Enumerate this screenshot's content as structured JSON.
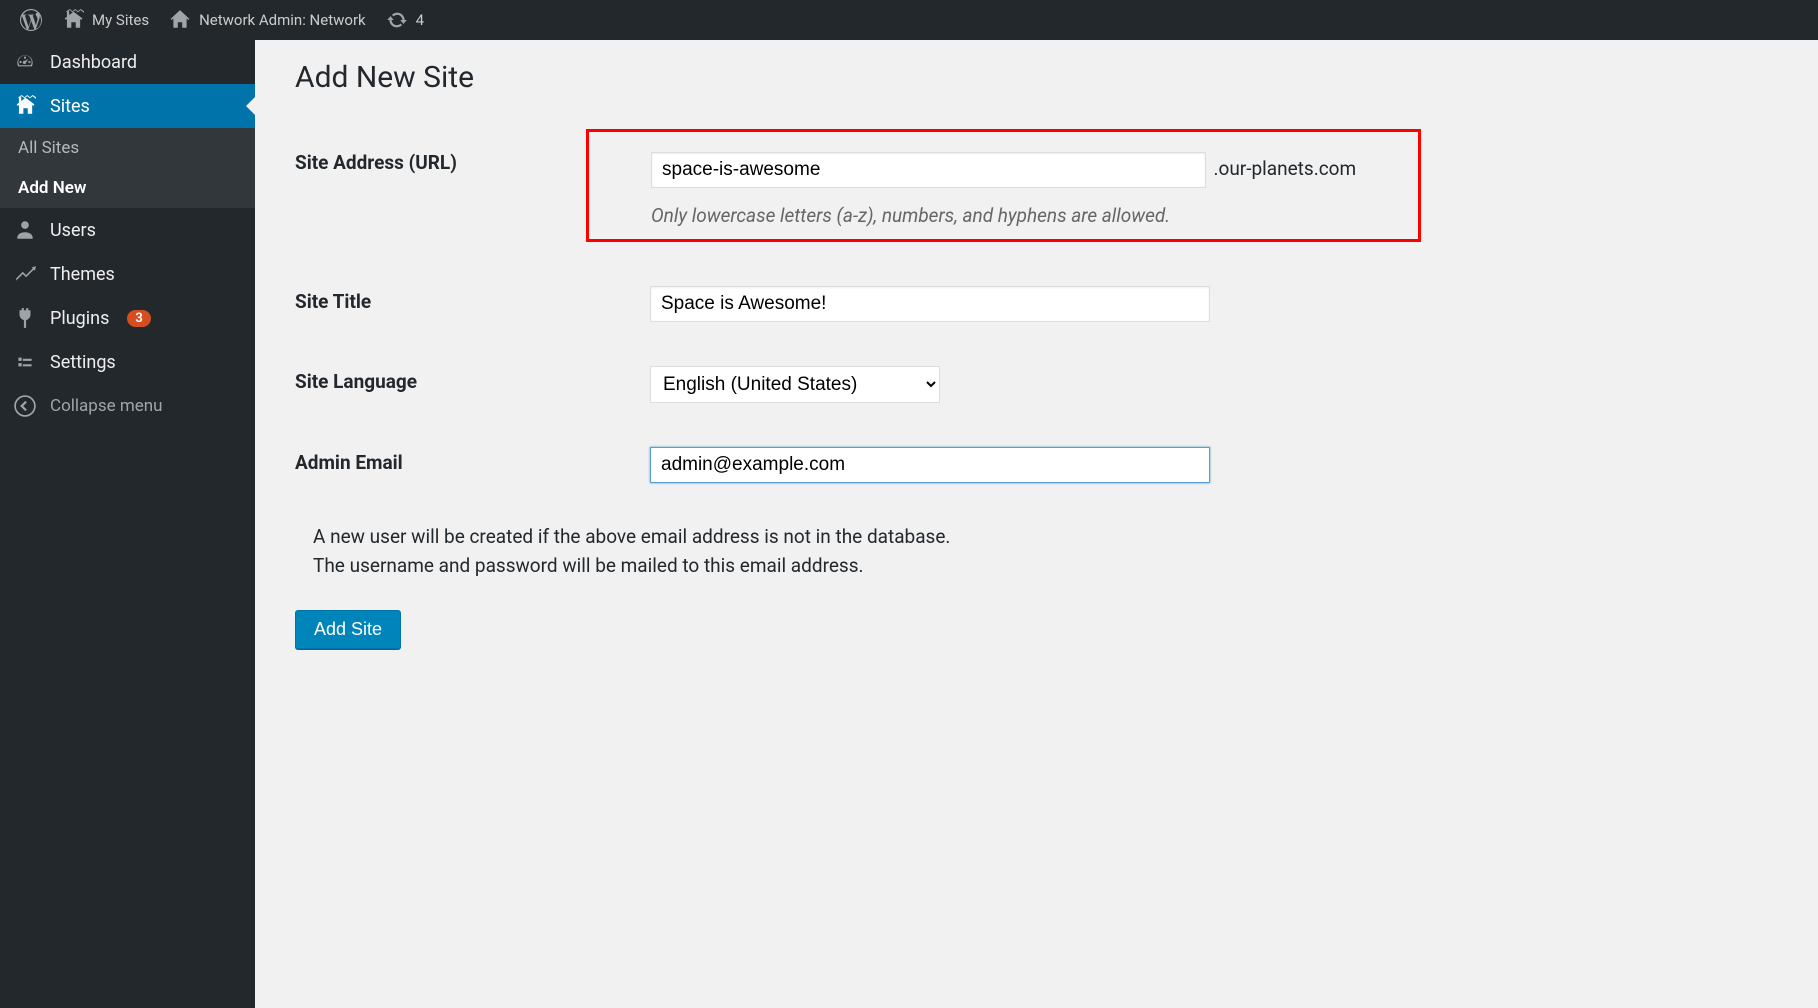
{
  "adminbar": {
    "my_sites": "My Sites",
    "network_admin": "Network Admin: Network",
    "updates_count": "4"
  },
  "sidebar": {
    "dashboard": "Dashboard",
    "sites": "Sites",
    "sites_sub": {
      "all_sites": "All Sites",
      "add_new": "Add New"
    },
    "users": "Users",
    "themes": "Themes",
    "plugins": "Plugins",
    "plugins_badge": "3",
    "settings": "Settings",
    "collapse": "Collapse menu"
  },
  "page": {
    "title": "Add New Site"
  },
  "form": {
    "site_address_label": "Site Address (URL)",
    "site_address_value": "space-is-awesome",
    "domain_suffix": ".our-planets.com",
    "site_address_desc": "Only lowercase letters (a-z), numbers, and hyphens are allowed.",
    "site_title_label": "Site Title",
    "site_title_value": "Space is Awesome!",
    "site_language_label": "Site Language",
    "site_language_value": "English (United States)",
    "admin_email_label": "Admin Email",
    "admin_email_value": "admin@example.com",
    "note_line1": "A new user will be created if the above email address is not in the database.",
    "note_line2": "The username and password will be mailed to this email address.",
    "submit": "Add Site"
  }
}
